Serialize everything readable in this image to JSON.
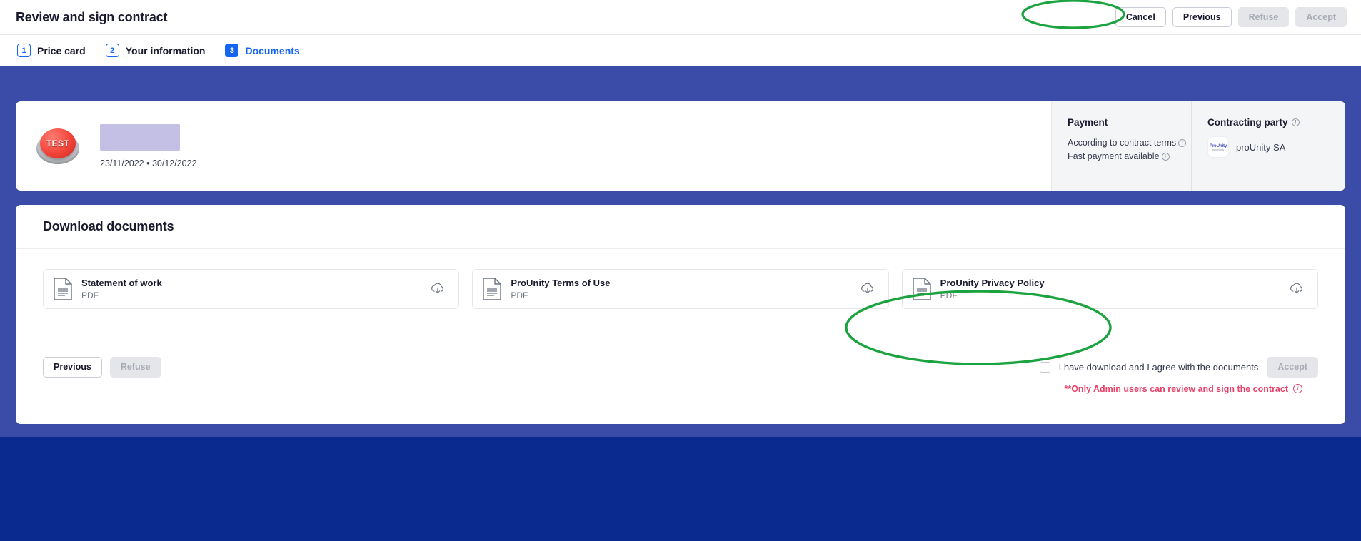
{
  "header": {
    "title": "Review and sign contract",
    "buttons": [
      {
        "label": "Cancel",
        "state": "enabled",
        "name": "cancel-button"
      },
      {
        "label": "Previous",
        "state": "enabled",
        "name": "previous-button"
      },
      {
        "label": "Refuse",
        "state": "disabled",
        "name": "refuse-button"
      },
      {
        "label": "Accept",
        "state": "disabled",
        "name": "accept-button"
      }
    ]
  },
  "steps": [
    {
      "number": "1",
      "label": "Price card",
      "active": false
    },
    {
      "number": "2",
      "label": "Your information",
      "active": false
    },
    {
      "number": "3",
      "label": "Documents",
      "active": true
    }
  ],
  "summary": {
    "badge_text": "TEST",
    "title_redacted": true,
    "dates": "23/11/2022 • 30/12/2022",
    "payment": {
      "heading": "Payment",
      "lines": [
        "According to contract terms",
        "Fast payment available"
      ]
    },
    "contracting_party": {
      "heading": "Contracting party",
      "logo_line1": "ProUnity",
      "logo_line2": "by proUnity",
      "name": "proUnity SA"
    }
  },
  "documents_section": {
    "title": "Download documents",
    "items": [
      {
        "name": "Statement of work",
        "type": "PDF"
      },
      {
        "name": "ProUnity Terms of Use",
        "type": "PDF"
      },
      {
        "name": "ProUnity Privacy Policy",
        "type": "PDF"
      }
    ],
    "footer": {
      "previous_label": "Previous",
      "refuse_label": "Refuse",
      "accept_label": "Accept",
      "agree_label": "I have download and I agree with the documents",
      "agree_checked": false,
      "warning": "**Only Admin users can review and sign the contract"
    }
  },
  "colors": {
    "accent_blue": "#1665f0",
    "page_blue": "#3b4ba8",
    "deep_blue": "#0a2a8f",
    "warning_pink": "#e8416a",
    "annotation_green": "#1aa33f"
  }
}
